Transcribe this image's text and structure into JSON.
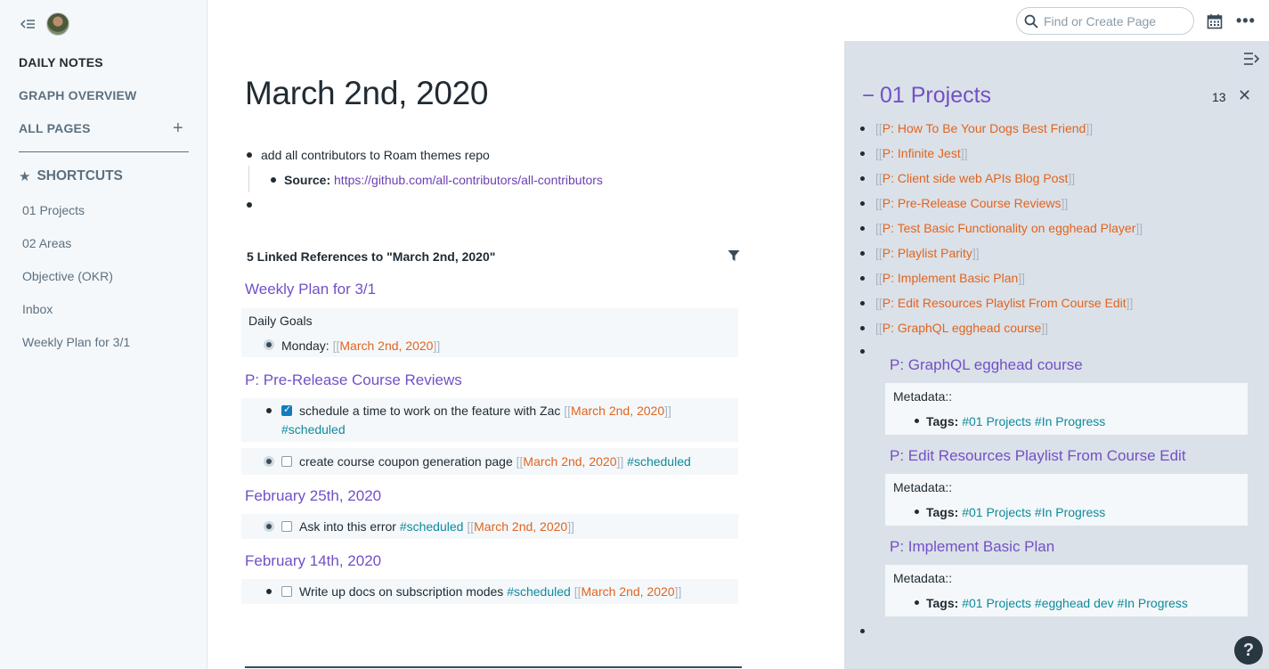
{
  "sidebar": {
    "nav": {
      "daily_notes": "DAILY NOTES",
      "graph_overview": "GRAPH OVERVIEW",
      "all_pages": "ALL PAGES"
    },
    "shortcuts_label": "SHORTCUTS",
    "shortcuts": [
      "01 Projects",
      "02 Areas",
      "Objective (OKR)",
      "Inbox",
      "Weekly Plan for 3/1"
    ]
  },
  "topbar": {
    "search_placeholder": "Find or Create Page",
    "more": "•••"
  },
  "page": {
    "title": "March 2nd, 2020",
    "block1": "add all contributors to Roam themes repo",
    "source_label": "Source:",
    "source_url": "https://github.com/all-contributors/all-contributors"
  },
  "linked_refs": {
    "header": "5 Linked References to \"March 2nd, 2020\"",
    "groups": [
      {
        "title": "Weekly Plan for 3/1",
        "parent": "Daily Goals",
        "item_text": "Monday:",
        "item_link": "March 2nd, 2020"
      },
      {
        "title": "P: Pre-Release Course Reviews",
        "item1_text": "schedule a time to work on the feature with Zac",
        "item1_link": "March 2nd, 2020",
        "item1_tag": "#scheduled",
        "item2_text": "create course coupon generation page",
        "item2_link": "March 2nd, 2020",
        "item2_tag": "#scheduled"
      },
      {
        "title": "February 25th, 2020",
        "item_text": "Ask into this error",
        "item_tag": "#scheduled",
        "item_link": "March 2nd, 2020"
      },
      {
        "title": "February 14th, 2020",
        "item_text": "Write up docs on subscription modes",
        "item_tag": "#scheduled",
        "item_link": "March 2nd, 2020"
      }
    ]
  },
  "right_sidebar": {
    "minus": "−",
    "title": "01 Projects",
    "count": "13",
    "links": [
      "P: How To Be Your Dogs Best Friend",
      "P: Infinite Jest",
      "P: Client side web APIs Blog Post",
      "P: Pre-Release Course Reviews",
      "P: Test Basic Functionality on egghead Player",
      "P: Playlist Parity",
      "P: Implement Basic Plan",
      "P: Edit Resources Playlist From Course Edit",
      "P: GraphQL egghead course"
    ],
    "embeds": [
      {
        "title": "P: GraphQL egghead course",
        "metadata": "Metadata::",
        "tags_label": "Tags:",
        "tags": "#01 Projects #In Progress"
      },
      {
        "title": "P: Edit Resources Playlist From Course Edit",
        "metadata": "Metadata::",
        "tags_label": "Tags:",
        "tags": "#01 Projects #In Progress"
      },
      {
        "title": "P: Implement Basic Plan",
        "metadata": "Metadata::",
        "tags_label": "Tags:",
        "tags": "#01 Projects #egghead dev #In Progress"
      }
    ],
    "help": "?"
  },
  "colors": {
    "page_link": "#e0641f",
    "tag": "#0d8a9c",
    "ref_title": "#7250c8",
    "right_sidebar_bg": "#dbe1e8"
  },
  "icons": [
    "collapse-sidebar-icon",
    "search-icon",
    "calendar-icon",
    "more-icon",
    "plus-icon",
    "star-icon",
    "filter-icon",
    "right-sidebar-toggle-icon",
    "close-icon",
    "help-icon"
  ]
}
